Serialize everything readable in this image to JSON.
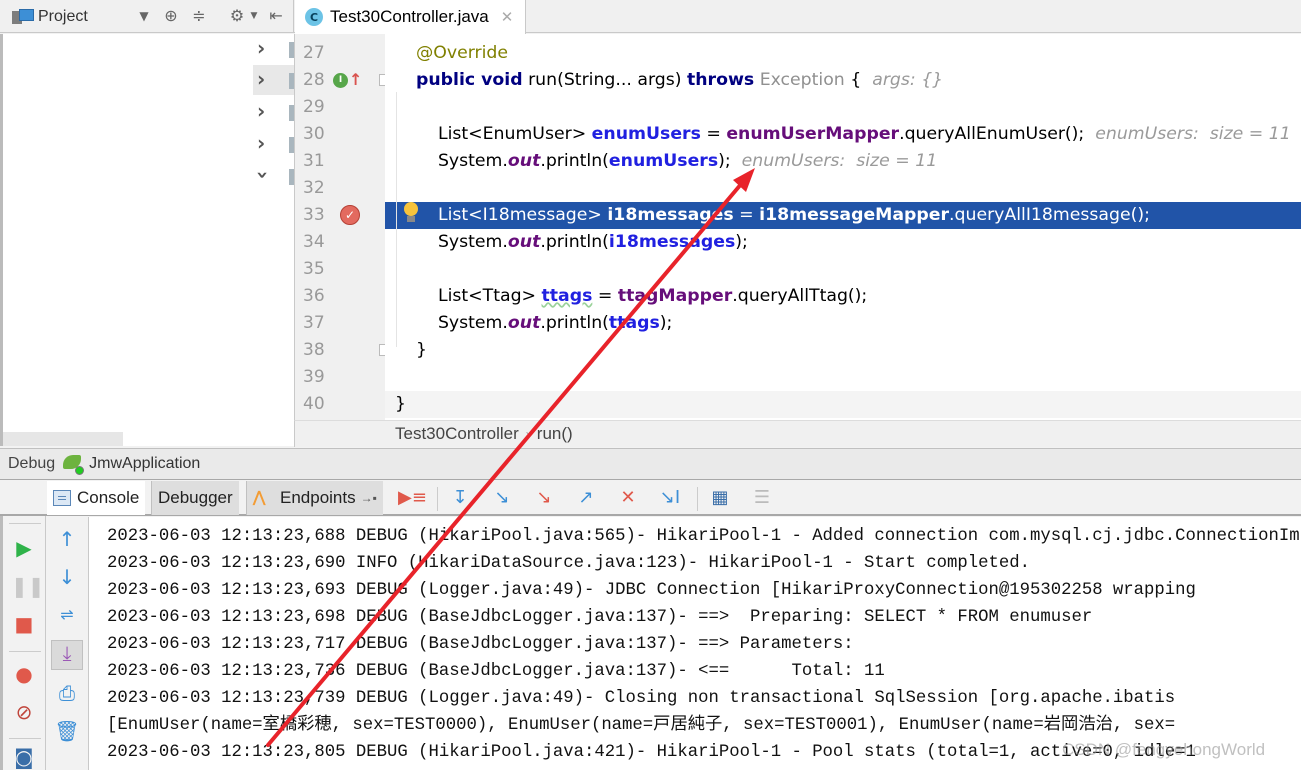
{
  "topbar": {
    "project_label": "Project",
    "file_tab": {
      "icon_letter": "C",
      "label": "Test30Controller.java",
      "close": "✕"
    }
  },
  "editor": {
    "lines": [
      {
        "num": "27"
      },
      {
        "num": "28"
      },
      {
        "num": "29"
      },
      {
        "num": "30"
      },
      {
        "num": "31"
      },
      {
        "num": "32"
      },
      {
        "num": "33"
      },
      {
        "num": "34"
      },
      {
        "num": "35"
      },
      {
        "num": "36"
      },
      {
        "num": "37"
      },
      {
        "num": "38"
      },
      {
        "num": "39"
      },
      {
        "num": "40"
      }
    ],
    "code": {
      "l27_ann": "@Override",
      "l28_kw1": "public void",
      "l28_a": " run(String... args) ",
      "l28_kw2": "throws",
      "l28_b": " Exception",
      "l28_c": " {  ",
      "l28_hint": "args: {}",
      "l30_a": "List<EnumUser> ",
      "l30_var": "enumUsers",
      "l30_b": " = ",
      "l30_fld": "enumUserMapper",
      "l30_c": ".queryAllEnumUser();  ",
      "l30_hint": "enumUsers:  size = 11",
      "l31_a": "System.",
      "l31_st": "out",
      "l31_b": ".println(",
      "l31_var": "enumUsers",
      "l31_c": ");  ",
      "l31_hint": "enumUsers:  size = 11",
      "l33_a": "List<I18message> ",
      "l33_var": "i18messages",
      "l33_b": " = ",
      "l33_fld": "i18messageMapper",
      "l33_c": ".queryAllI18message();",
      "l34_a": "System.",
      "l34_st": "out",
      "l34_b": ".println(",
      "l34_var": "i18messages",
      "l34_c": ");",
      "l36_a": "List<Ttag> ",
      "l36_var": "ttags",
      "l36_b": " = ",
      "l36_fld": "ttagMapper",
      "l36_c": ".queryAllTtag();",
      "l37_a": "System.",
      "l37_st": "out",
      "l37_b": ".println(",
      "l37_var": "ttags",
      "l37_c": ");",
      "l38": "}",
      "l40": "}"
    },
    "breadcrumb": {
      "class": "Test30Controller",
      "method": "run()",
      "sep": "›"
    }
  },
  "debug": {
    "title": "Debug",
    "app": "JmwApplication",
    "tabs": [
      {
        "label": "Console",
        "active": true
      },
      {
        "label": "Debugger",
        "active": false
      },
      {
        "label": "Endpoints",
        "active": false
      }
    ],
    "more_arrow": "→▪"
  },
  "console": {
    "lines": [
      "2023-06-03 12:13:23,688 DEBUG (HikariPool.java:565)- HikariPool-1 - Added connection com.mysql.cj.jdbc.ConnectionImpl",
      "2023-06-03 12:13:23,690 INFO (HikariDataSource.java:123)- HikariPool-1 - Start completed.",
      "2023-06-03 12:13:23,693 DEBUG (Logger.java:49)- JDBC Connection [HikariProxyConnection@195302258 wrapping",
      "2023-06-03 12:13:23,698 DEBUG (BaseJdbcLogger.java:137)- ==>  Preparing: SELECT * FROM enumuser",
      "2023-06-03 12:13:23,717 DEBUG (BaseJdbcLogger.java:137)- ==> Parameters: ",
      "2023-06-03 12:13:23,736 DEBUG (BaseJdbcLogger.java:137)- <==      Total: 11",
      "2023-06-03 12:13:23,739 DEBUG (Logger.java:49)- Closing non transactional SqlSession [org.apache.ibatis",
      "[EnumUser(name=室橋彩穂, sex=TEST0000), EnumUser(name=戸居純子, sex=TEST0001), EnumUser(name=岩岡浩治, sex=",
      "2023-06-03 12:13:23,805 DEBUG (HikariPool.java:421)- HikariPool-1 - Pool stats (total=1, active=0, idle=1"
    ]
  },
  "watermark": "CSDN @fengyehongWorld",
  "colors": {
    "highlight": "#2154a8",
    "annotation_arrow": "#e8232a"
  }
}
